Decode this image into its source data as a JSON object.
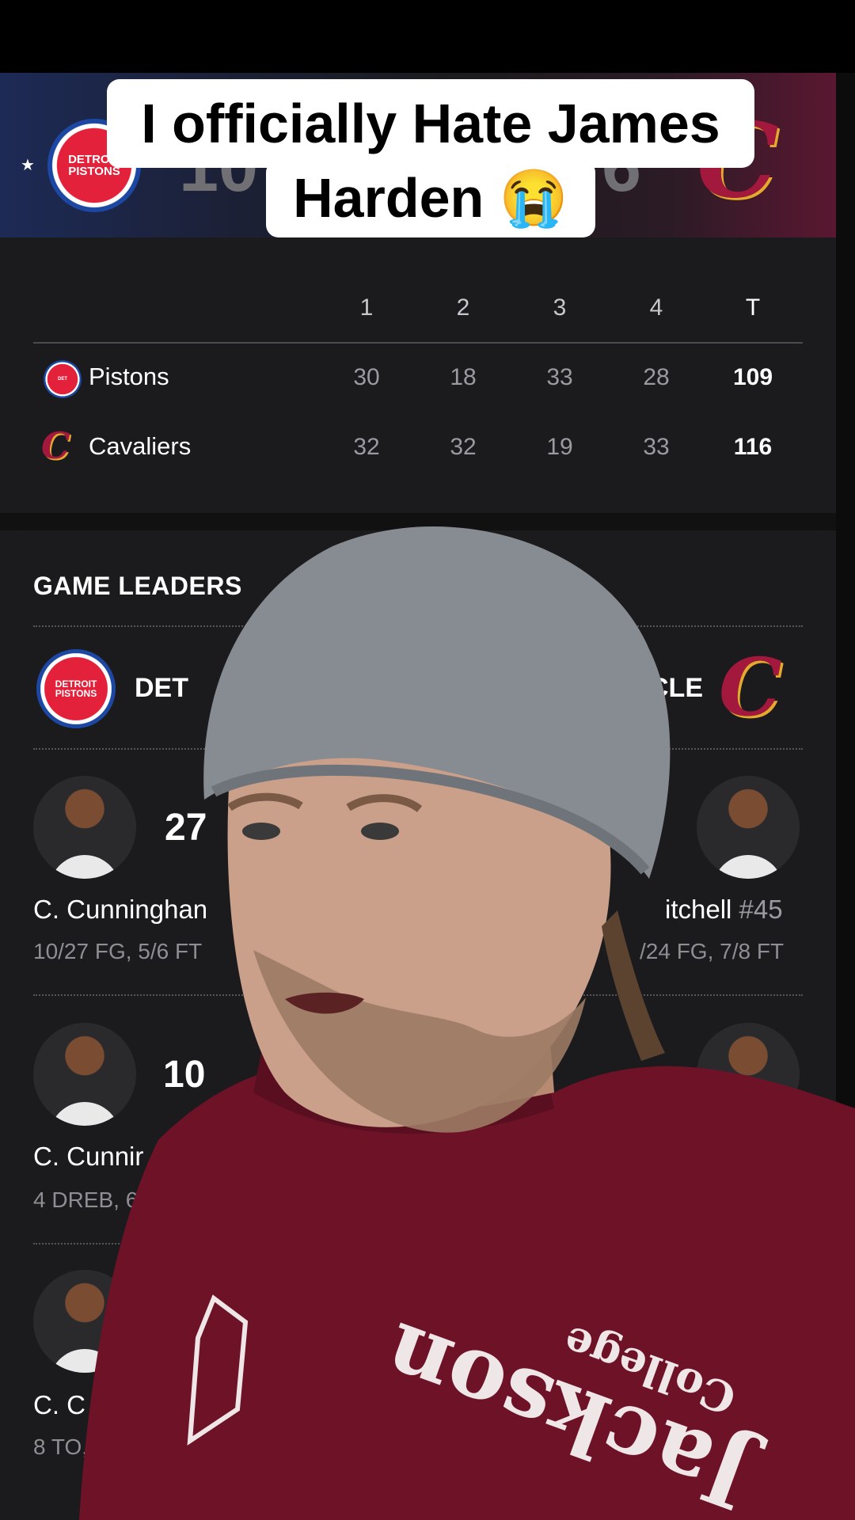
{
  "caption": {
    "line1": "I officially Hate James",
    "line2": "Harden 😭"
  },
  "header": {
    "home_logo_text": "DETROIT PISTONS",
    "away_logo_text": "C",
    "home_score_partial": "10",
    "away_score_partial": "6"
  },
  "linescore": {
    "headers": [
      "1",
      "2",
      "3",
      "4",
      "T"
    ],
    "rows": [
      {
        "team": "Pistons",
        "q": [
          "30",
          "18",
          "33",
          "28"
        ],
        "total": "109"
      },
      {
        "team": "Cavaliers",
        "q": [
          "32",
          "32",
          "19",
          "33"
        ],
        "total": "116"
      }
    ]
  },
  "leaders": {
    "title": "GAME LEADERS",
    "home_abbr": "DET",
    "away_abbr": "CLE",
    "rows": [
      {
        "stat": "27",
        "home_name": "C. Cunninghan",
        "home_line": "10/27 FG, 5/6 FT",
        "away_name": "itchell",
        "away_num": "#45",
        "away_line": "/24 FG, 7/8 FT"
      },
      {
        "stat": "10",
        "home_name": "C. Cunnir",
        "home_line": "4 DREB, 6"
      },
      {
        "home_name": "C. C",
        "home_line": "8 TO,"
      }
    ]
  },
  "shirt_text": "Jackson College"
}
